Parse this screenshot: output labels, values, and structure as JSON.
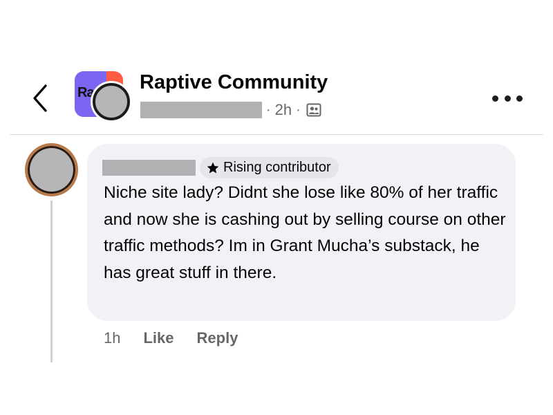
{
  "header": {
    "group_name": "Raptive Community",
    "logo_text": "Rap",
    "separator": "·",
    "post_time": "2h",
    "back_icon": "chevron-left-icon",
    "more_icon": "more-horizontal-icon",
    "audience_icon": "members-audience-icon"
  },
  "comment": {
    "badge_label": "Rising contributor",
    "badge_icon": "star-icon",
    "text": "Niche site lady? Didnt she lose like 80% of her traffic and now she is cashing out by selling course on other traffic methods? Im in Grant Mucha’s substack, he has great stuff in there.",
    "time": "1h",
    "like_label": "Like",
    "reply_label": "Reply"
  },
  "colors": {
    "bubble_bg": "#f0f2f5",
    "secondary_text": "#65676b",
    "badge_bg": "#e4e6eb",
    "logo_orange": "#ff5c45",
    "logo_purple": "#7a66f0"
  }
}
